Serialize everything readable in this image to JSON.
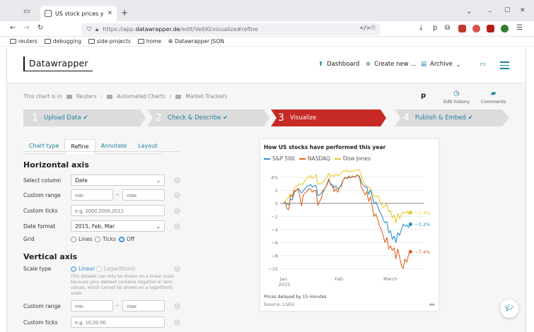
{
  "browser": {
    "tab_title": "US stock prices year to da",
    "url_prefix": "https://app.",
    "url_domain": "datawrapper.de",
    "url_path": "/edit/Ve6I0/visualize#refine",
    "bookmarks": [
      "reuters",
      "debugging",
      "side-projects",
      "home",
      "Datawrapper JSON"
    ]
  },
  "header": {
    "logo": "Datawrapper",
    "nav": [
      {
        "label": "Dashboard",
        "icon": "rocket-icon"
      },
      {
        "label": "Create new ...",
        "icon": "plus-circle-icon"
      },
      {
        "label": "Archive",
        "icon": "archive-icon"
      }
    ]
  },
  "breadcrumb": {
    "prefix": "This chart is in",
    "items": [
      "Reuters",
      "Automated Charts",
      "Market Trackers"
    ]
  },
  "tools": [
    {
      "label": "",
      "icon": "p-logo-icon"
    },
    {
      "label": "Edit history",
      "icon": "clock-icon"
    },
    {
      "label": "Comments",
      "icon": "comment-icon"
    }
  ],
  "steps": [
    {
      "num": "1",
      "label": "Upload Data",
      "check": true
    },
    {
      "num": "2",
      "label": "Check & Describe",
      "check": true
    },
    {
      "num": "3",
      "label": "Visualize",
      "check": false,
      "active": true
    },
    {
      "num": "4",
      "label": "Publish & Embed",
      "check": true
    }
  ],
  "panel_tabs": [
    "Chart type",
    "Refine",
    "Annotate",
    "Layout"
  ],
  "horizontal_axis": {
    "title": "Horizontal axis",
    "select_column_label": "Select column",
    "select_column_value": "Date",
    "custom_range_label": "Custom range",
    "min_placeholder": "min",
    "max_placeholder": "max",
    "custom_ticks_label": "Custom ticks",
    "custom_ticks_placeholder": "e.g. 2000,2005,2012",
    "date_format_label": "Date format",
    "date_format_value": "2015, Feb, Mar",
    "grid_label": "Grid",
    "grid_options": [
      "Lines",
      "Ticks",
      "Off"
    ],
    "grid_selected": "Off"
  },
  "vertical_axis": {
    "title": "Vertical axis",
    "scale_type_label": "Scale type",
    "scale_options": [
      "Linear",
      "Logarithmic"
    ],
    "scale_selected": "Linear",
    "note": "This dataset can only be shown on a linear scale because your dataset contains negative or zero values, which cannot be shown on a logarithmic scale.",
    "custom_range_label": "Custom range",
    "min_placeholder": "min",
    "max_placeholder": "max",
    "custom_ticks_label": "Custom ticks",
    "custom_ticks_placeholder": "e.g. 10,20,50"
  },
  "colors": {
    "accent": "#1d81a2",
    "active_step": "#c72a25",
    "step_bg": "#dcdcdc"
  },
  "chart_data": {
    "type": "line",
    "title": "How US stocks have performed this year",
    "xlabel": "",
    "ylabel": "",
    "yticks": [
      4,
      2,
      0,
      -2,
      -4,
      -6,
      -8,
      -10
    ],
    "ytick_labels": [
      "4%",
      "2",
      "0",
      "−2",
      "−4",
      "−6",
      "−8",
      "−10"
    ],
    "ylim": [
      -10.5,
      5.5
    ],
    "xticks": [
      {
        "pos": 0.5,
        "label": "Jan.",
        "sub": "2025"
      },
      {
        "pos": 31,
        "label": "Feb.",
        "sub": ""
      },
      {
        "pos": 59,
        "label": "March",
        "sub": ""
      }
    ],
    "xlim": [
      -1,
      73
    ],
    "grid": true,
    "series": [
      {
        "name": "S&P 500",
        "color": "#2a8fd1",
        "end_label": "−3.2%",
        "values": [
          0,
          0.1,
          -0.1,
          -0.2,
          0.7,
          0.5,
          1.7,
          1.9,
          2.2,
          2.0,
          1.6,
          1.9,
          2.3,
          2.6,
          2.7,
          2.9,
          2.5,
          2.7,
          2.7,
          1.2,
          1.3,
          1.6,
          2.0,
          2.3,
          2.8,
          3.5,
          3.0,
          2.9,
          2.4,
          2.7,
          2.2,
          2.4,
          2.9,
          3.6,
          3.9,
          3.8,
          4.0,
          3.9,
          4.1,
          4.0,
          4.2,
          4.3,
          4.1,
          3.2,
          2.8,
          2.5,
          2.5,
          1.4,
          2.0,
          1.0,
          -0.1,
          0.2,
          -0.5,
          -1.3,
          -1.7,
          -2.5,
          -3.0,
          -2.8,
          -4.5,
          -4.2,
          -5.5,
          -5.0,
          -6.0,
          -4.5,
          -4.9,
          -4.0,
          -3.2,
          -3.5,
          -3.3,
          -3.7,
          -3.2
        ]
      },
      {
        "name": "NASDAQ",
        "color": "#e0641f",
        "end_label": "−7.4%",
        "values": [
          0,
          0.2,
          -0.8,
          -1.0,
          1.3,
          1.0,
          2.0,
          1.9,
          2.3,
          1.2,
          -0.4,
          1.3,
          1.6,
          1.8,
          2.3,
          2.2,
          1.7,
          2.0,
          1.9,
          -0.3,
          0.3,
          0.8,
          1.8,
          2.3,
          2.9,
          3.8,
          2.8,
          2.7,
          1.8,
          2.2,
          1.7,
          2.5,
          2.6,
          3.6,
          4.0,
          3.8,
          4.2,
          3.9,
          4.2,
          4.0,
          4.1,
          4.4,
          3.9,
          2.4,
          2.0,
          1.3,
          1.8,
          0.3,
          1.0,
          -0.6,
          -2.0,
          -1.6,
          -2.5,
          -3.5,
          -4.0,
          -5.0,
          -6.0,
          -5.2,
          -7.0,
          -6.5,
          -7.2,
          -6.8,
          -8.5,
          -7.0,
          -8.2,
          -9.5,
          -10.0,
          -8.5,
          -9.0,
          -7.8,
          -7.4
        ]
      },
      {
        "name": "Dow Jones",
        "color": "#e6c928",
        "end_label": "−1.4%",
        "values": [
          0,
          0.3,
          0.6,
          0.9,
          1.4,
          1.3,
          2.2,
          2.6,
          2.8,
          3.0,
          2.9,
          3.0,
          3.5,
          3.9,
          4.0,
          4.3,
          3.8,
          4.1,
          4.4,
          3.0,
          3.0,
          3.1,
          3.3,
          3.7,
          4.0,
          4.6,
          4.1,
          4.3,
          4.1,
          4.5,
          4.2,
          4.4,
          4.6,
          5.0,
          4.9,
          5.1,
          4.8,
          5.0,
          4.9,
          5.0,
          5.1,
          5.2,
          5.0,
          4.2,
          3.4,
          2.9,
          2.6,
          2.5,
          2.3,
          1.5,
          1.1,
          1.0,
          1.2,
          0.5,
          -0.1,
          -0.6,
          -0.4,
          -0.1,
          -1.3,
          -1.1,
          -2.2,
          -1.8,
          -3.0,
          -1.5,
          -2.3,
          -1.8,
          -1.3,
          -1.5,
          -1.2,
          -1.6,
          -1.4
        ]
      }
    ],
    "source_note": "Prices delayed by 15 minutes",
    "source": "Source: LSEG"
  }
}
